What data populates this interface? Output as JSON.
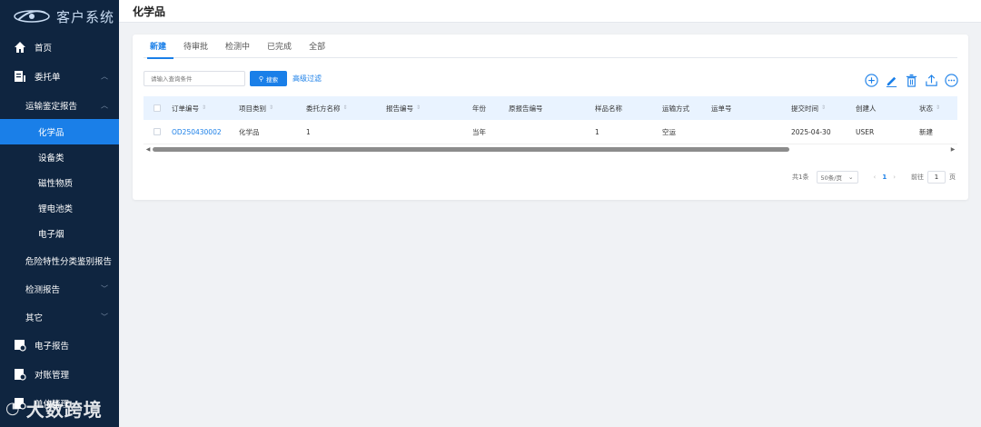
{
  "app": {
    "title": "客户系统"
  },
  "page": {
    "title": "化学品"
  },
  "sidebar": {
    "home": "首页",
    "commission": "委托单",
    "transport_report": "运输鉴定报告",
    "sub_items": [
      "化学品",
      "设备类",
      "磁性物质",
      "锂电池类",
      "电子烟"
    ],
    "hazard": "危险特性分类鉴别报告",
    "testing": "检测报告",
    "other": "其它",
    "e_report": "电子报告",
    "reconcile": "对账管理",
    "unit": "单位管理"
  },
  "watermark": "大数跨境",
  "tabs": [
    "新建",
    "待审批",
    "检测中",
    "已完成",
    "全部"
  ],
  "search": {
    "placeholder": "请输入查询条件",
    "button": "搜索",
    "advanced": "高级过滤"
  },
  "toolbar_icons": [
    "add-circle-icon",
    "edit-icon",
    "delete-icon",
    "upload-icon",
    "more-icon"
  ],
  "table": {
    "headers": [
      "订单编号",
      "项目类别",
      "委托方名称",
      "报告编号",
      "年份",
      "原报告编号",
      "样品名称",
      "运输方式",
      "运单号",
      "提交时间",
      "创建人",
      "状态"
    ],
    "rows": [
      [
        "OD250430002",
        "化学品",
        "1",
        "",
        "当年",
        "",
        "1",
        "空运",
        "",
        "2025-04-30",
        "USER",
        "新建"
      ]
    ]
  },
  "pager": {
    "total": "共1条",
    "page_size": "50条/页",
    "current": "1",
    "goto_label": "前往",
    "goto_value": "1",
    "page_unit": "页"
  },
  "colors": {
    "accent": "#1a7fe8",
    "sidebar": "#0f2540"
  }
}
